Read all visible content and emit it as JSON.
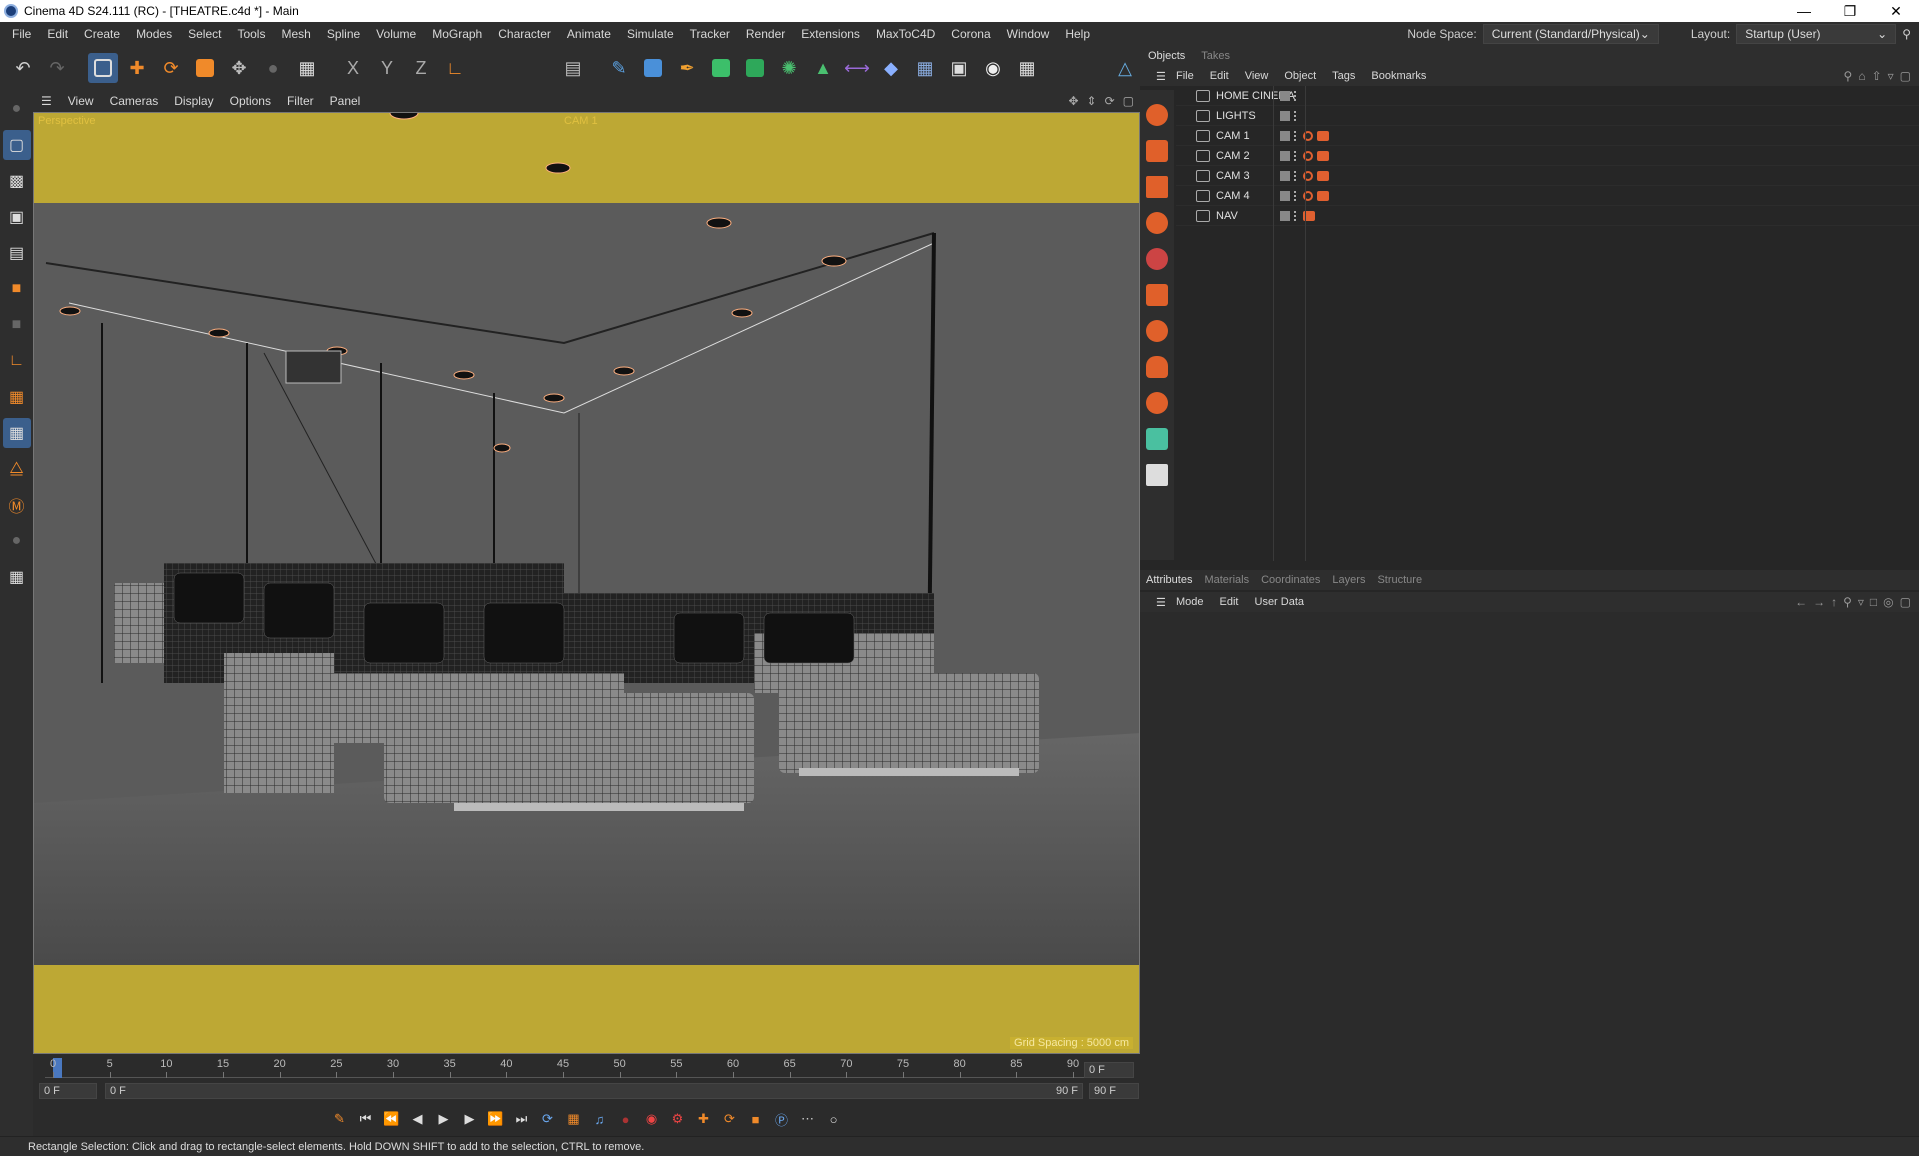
{
  "window": {
    "title": "Cinema 4D S24.111 (RC) - [THEATRE.c4d *] - Main"
  },
  "menu": [
    "File",
    "Edit",
    "Create",
    "Modes",
    "Select",
    "Tools",
    "Mesh",
    "Spline",
    "Volume",
    "MoGraph",
    "Character",
    "Animate",
    "Simulate",
    "Tracker",
    "Render",
    "Extensions",
    "MaxToC4D",
    "Corona",
    "Window",
    "Help"
  ],
  "node_space": {
    "label": "Node Space:",
    "value": "Current (Standard/Physical)"
  },
  "layout": {
    "label": "Layout:",
    "value": "Startup (User)"
  },
  "viewport_menu": [
    "View",
    "Cameras",
    "Display",
    "Options",
    "Filter",
    "Panel"
  ],
  "viewport": {
    "name": "Perspective",
    "camera": "CAM 1",
    "grid_spacing": "Grid Spacing : 5000 cm"
  },
  "timeline": {
    "ticks": [
      "0",
      "5",
      "10",
      "15",
      "20",
      "25",
      "30",
      "35",
      "40",
      "45",
      "50",
      "55",
      "60",
      "65",
      "70",
      "75",
      "80",
      "85",
      "90"
    ],
    "current_frame": "0 F",
    "start": "0 F",
    "range_start": "0 F",
    "range_end": "90 F",
    "end": "90 F"
  },
  "status": "Rectangle Selection: Click and drag to rectangle-select elements. Hold DOWN SHIFT to add to the selection, CTRL to remove.",
  "right_tabs": [
    "Objects",
    "Takes"
  ],
  "object_menu": [
    "File",
    "Edit",
    "View",
    "Object",
    "Tags",
    "Bookmarks"
  ],
  "objects": [
    {
      "name": "HOME CINEMA",
      "type": "null",
      "tags": 0
    },
    {
      "name": "LIGHTS",
      "type": "null",
      "tags": 0
    },
    {
      "name": "CAM 1",
      "type": "camera",
      "tags": 2
    },
    {
      "name": "CAM 2",
      "type": "camera",
      "tags": 2
    },
    {
      "name": "CAM 3",
      "type": "camera",
      "tags": 2
    },
    {
      "name": "CAM 4",
      "type": "camera",
      "tags": 2
    },
    {
      "name": "NAV",
      "type": "camera",
      "tags": 1
    }
  ],
  "attr_tabs": [
    "Attributes",
    "Materials",
    "Coordinates",
    "Layers",
    "Structure"
  ],
  "attr_menu": [
    "Mode",
    "Edit",
    "User Data"
  ],
  "colors": {
    "accent": "#3b5f8c",
    "tag_orange": "#e0602a",
    "safe_frame": "#c8b030"
  }
}
